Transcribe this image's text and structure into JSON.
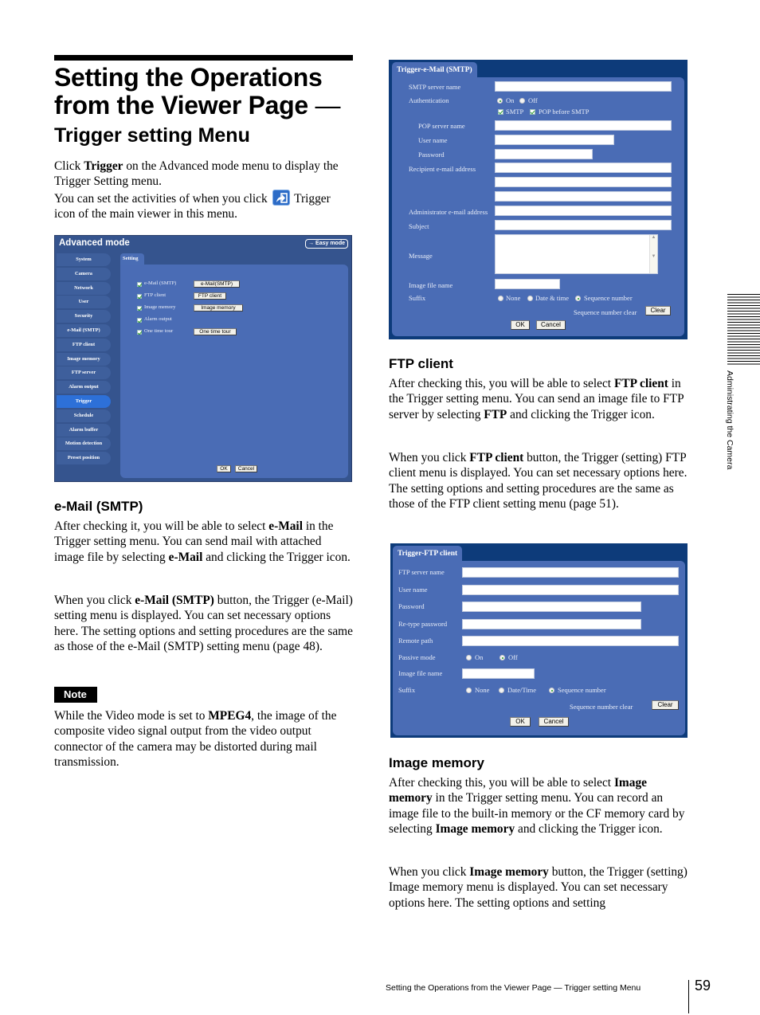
{
  "heading": {
    "title_line1": "Setting the Operations",
    "title_line2": "from the Viewer Page",
    "title_dash": "—",
    "subtitle": "Trigger setting Menu"
  },
  "intro": {
    "p1_pre": "Click ",
    "p1_bold": "Trigger",
    "p1_post": " on the Advanced mode menu to display the Trigger Setting menu.",
    "p2_pre": "You can set the activities of when you click",
    "p2_post": "Trigger icon of the main viewer in this menu.",
    "icon": "trigger-icon"
  },
  "advanced_screenshot": {
    "title": "Advanced mode",
    "easy_mode_button": "→ Easy mode",
    "menu": [
      "System",
      "Camera",
      "Network",
      "User",
      "Security",
      "e-Mail (SMTP)",
      "FTP client",
      "Image memory",
      "FTP server",
      "Alarm output",
      "Trigger",
      "Schedule",
      "Alarm buffer",
      "Motion detection",
      "Preset position"
    ],
    "active_menu": "Trigger",
    "tab": "Setting",
    "options": [
      {
        "label": "e-Mail (SMTP)",
        "checked": true,
        "button": "e-Mail(SMTP)"
      },
      {
        "label": "FTP client",
        "checked": true,
        "button": "FTP client"
      },
      {
        "label": "Image memory",
        "checked": true,
        "button": "Image memory"
      },
      {
        "label": "Alarm output",
        "checked": true,
        "button": ""
      },
      {
        "label": "One time tour",
        "checked": true,
        "button": "One time tour"
      }
    ],
    "ok": "OK",
    "cancel": "Cancel"
  },
  "email_section": {
    "heading": "e-Mail (SMTP)",
    "p1": [
      "After checking it, you will be able to select ",
      "e-Mail",
      " in the Trigger setting menu. You can send mail with attached image file by selecting ",
      "e-Mail",
      " and clicking the Trigger icon."
    ],
    "p2": [
      "When you click ",
      "e-Mail (SMTP)",
      " button, the Trigger (e-Mail) setting menu is displayed. You can set necessary options here. The setting options and setting procedures are the same as those of the e-Mail (SMTP) setting menu (page 48)."
    ],
    "note_label": "Note",
    "note": [
      "While the Video mode is set to ",
      "MPEG4",
      ", the image of the composite video signal output from the video output connector of the camera may be distorted during mail transmission."
    ]
  },
  "email_screenshot": {
    "tab": "Trigger-e-Mail (SMTP)",
    "smtp_server_name": "SMTP server name",
    "authentication": "Authentication",
    "auth_on": "On",
    "auth_off": "Off",
    "auth_selected": "On",
    "smtp_check": "SMTP",
    "pop_before_smtp_check": "POP before SMTP",
    "pop_server_name": "POP server name",
    "user_name": "User name",
    "password": "Password",
    "recipient": "Recipient e-mail address",
    "administrator": "Administrator e-mail address",
    "subject": "Subject",
    "message": "Message",
    "image_file_name": "Image file name",
    "suffix": "Suffix",
    "suffix_none": "None",
    "suffix_date": "Date & time",
    "suffix_seq": "Sequence number",
    "suffix_selected": "Sequence number",
    "seq_clear": "Sequence number clear",
    "clear": "Clear",
    "ok": "OK",
    "cancel": "Cancel"
  },
  "ftp_section": {
    "heading": "FTP client",
    "p1": [
      "After checking this, you will be able to select ",
      "FTP client",
      " in the Trigger setting menu. You can send an image file to FTP server by selecting ",
      "FTP",
      " and clicking the Trigger icon."
    ],
    "p2": [
      "When you click ",
      "FTP client",
      " button, the Trigger (setting) FTP client menu is displayed. You can set necessary options here. The setting options and setting procedures are the same as those of the FTP client setting menu (page 51)."
    ]
  },
  "ftp_screenshot": {
    "tab": "Trigger-FTP client",
    "ftp_server_name": "FTP server name",
    "user_name": "User name",
    "password": "Password",
    "retype_password": "Re-type password",
    "remote_path": "Remote path",
    "passive_mode": "Passive mode",
    "passive_on": "On",
    "passive_off": "Off",
    "passive_selected": "Off",
    "image_file_name": "Image file name",
    "suffix": "Suffix",
    "suffix_none": "None",
    "suffix_date": "Date/Time",
    "suffix_seq": "Sequence number",
    "suffix_selected": "Sequence number",
    "seq_clear": "Sequence number clear",
    "clear": "Clear",
    "ok": "OK",
    "cancel": "Cancel"
  },
  "image_memory_section": {
    "heading": "Image memory",
    "p1": [
      "After checking this, you will be able to select ",
      "Image memory",
      " in the Trigger setting menu. You can record an image file to the built-in memory or the CF memory card by selecting ",
      "Image memory",
      " and clicking the Trigger icon."
    ],
    "p2": [
      "When you click ",
      "Image memory",
      " button, the Trigger (setting) Image memory menu is displayed. You can set necessary options here. The setting options and setting"
    ]
  },
  "side_tab": "Administrating the Camera",
  "footer": {
    "running_title": "Setting the Operations from the Viewer Page — Trigger setting Menu",
    "page_number": "59"
  }
}
